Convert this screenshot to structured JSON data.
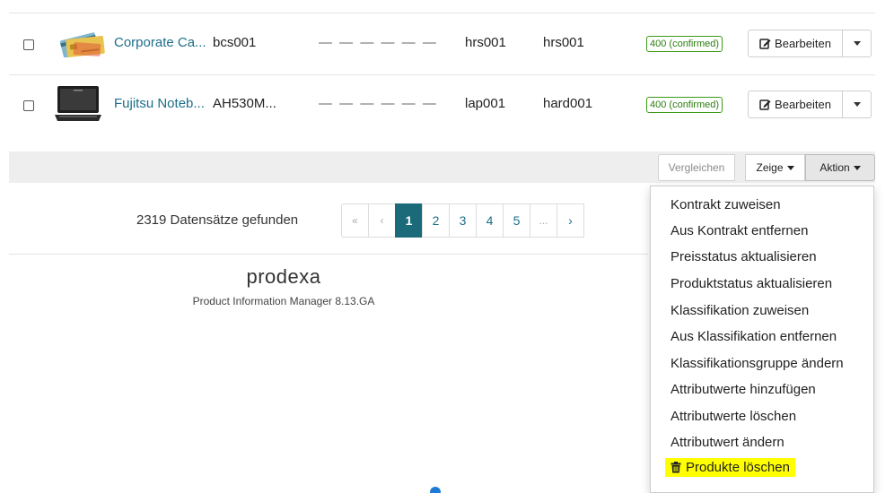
{
  "rows": [
    {
      "name": "Corporate Ca...",
      "sku": "bcs001",
      "dashes": "— — — — — —",
      "col1": "hrs001",
      "col2": "hrs001",
      "status": "400 (confirmed)",
      "edit_label": "Bearbeiten",
      "thumb_icon": "credit-cards-image"
    },
    {
      "name": "Fujitsu Noteb...",
      "sku": "AH530M...",
      "dashes": "— — — — — —",
      "col1": "lap001",
      "col2": "hard001",
      "status": "400 (confirmed)",
      "edit_label": "Bearbeiten",
      "thumb_icon": "laptop-image"
    }
  ],
  "toolbar": {
    "compare_label": "Vergleichen",
    "show_label": "Zeige",
    "action_label": "Aktion"
  },
  "pagination": {
    "found_text": "2319 Datensätze gefunden",
    "first": "«",
    "prev": "‹",
    "pages": [
      "1",
      "2",
      "3",
      "4",
      "5"
    ],
    "ellipsis": "...",
    "next": "›",
    "active_page": "1"
  },
  "footer": {
    "logo": "prodexa",
    "version": "Product Information Manager 8.13.GA"
  },
  "action_menu": {
    "items": [
      "Kontrakt zuweisen",
      "Aus Kontrakt entfernen",
      "Preisstatus aktualisieren",
      "Produktstatus aktualisieren",
      "Klassifikation zuweisen",
      "Aus Klassifikation entfernen",
      "Klassifikationsgruppe ändern",
      "Attributwerte hinzufügen",
      "Attributwerte löschen",
      "Attributwert ändern"
    ],
    "delete_label": "Produkte löschen",
    "delete_icon": "trash-icon",
    "highlight_color": "#ffff00"
  },
  "colors": {
    "link": "#1c6e8a",
    "active_page": "#1a6a7a",
    "status_green": "#3c9a17"
  }
}
